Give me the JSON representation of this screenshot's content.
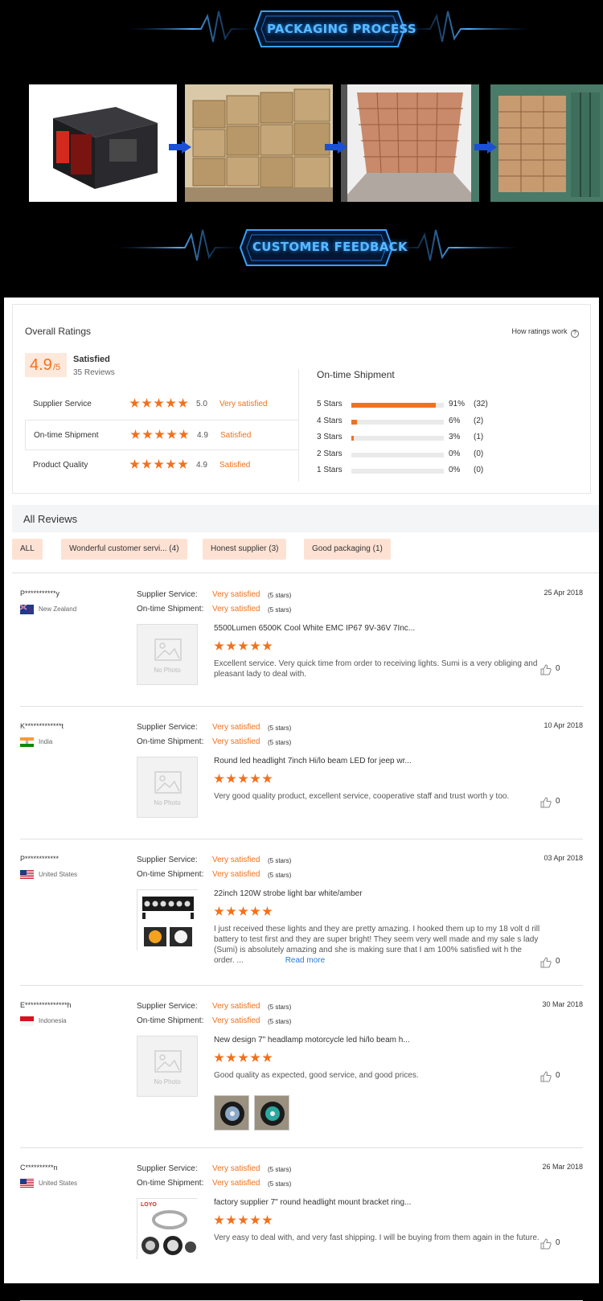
{
  "packaging": {
    "title": "PACKAGING PROCESS"
  },
  "feedback_banner": {
    "title": "CUSTOMER FEEDBACK"
  },
  "overall": {
    "title": "Overall Ratings",
    "how_link": "How ratings work",
    "score": "4.9",
    "score_suffix": "/5",
    "label": "Satisfied",
    "reviews": "35 Reviews",
    "rows": [
      {
        "label": "Supplier Service",
        "value": "5.0",
        "word": "Very satisfied"
      },
      {
        "label": "On-time Shipment",
        "value": "4.9",
        "word": "Satisfied"
      },
      {
        "label": "Product Quality",
        "value": "4.9",
        "word": "Satisfied"
      }
    ]
  },
  "ontime": {
    "title": "On-time Shipment",
    "rows": [
      {
        "label": "5 Stars",
        "pct": "91%",
        "count": "(32)",
        "fraction": 0.91
      },
      {
        "label": "4 Stars",
        "pct": "6%",
        "count": "(2)",
        "fraction": 0.06
      },
      {
        "label": "3 Stars",
        "pct": "3%",
        "count": "(1)",
        "fraction": 0.03
      },
      {
        "label": "2 Stars",
        "pct": "0%",
        "count": "(0)",
        "fraction": 0
      },
      {
        "label": "1 Stars",
        "pct": "0%",
        "count": "(0)",
        "fraction": 0
      }
    ]
  },
  "all_reviews": {
    "title": "All Reviews",
    "tags": [
      "ALL",
      "Wonderful customer servi... (4)",
      "Honest supplier (3)",
      "Good packaging (1)"
    ]
  },
  "review_labels": {
    "supplier": "Supplier Service:",
    "shipment": "On-time Shipment:",
    "no_photo": "No Photo",
    "read_more": "Read more"
  },
  "reviews": [
    {
      "name": "P***********y",
      "country": "New Zealand",
      "date": "25 Apr 2018",
      "supplier": "Very satisfied",
      "supplier_stars": "(5 stars)",
      "shipment": "Very satisfied",
      "shipment_stars": "(5 stars)",
      "product": "5500Lumen 6500K Cool White EMC IP67 9V-36V 7Inc...",
      "text": "Excellent service. Very quick time from order to receiving lights. Sumi is a very obliging and pleasant lady to deal with.",
      "likes": "0"
    },
    {
      "name": "K*************t",
      "country": "India",
      "date": "10 Apr 2018",
      "supplier": "Very satisfied",
      "supplier_stars": "(5 stars)",
      "shipment": "Very satisfied",
      "shipment_stars": "(5 stars)",
      "product": "Round led headlight 7inch Hi/lo beam LED for jeep wr...",
      "text": "Very good quality product, excellent service, cooperative staff  and trust worth y too.",
      "likes": "0"
    },
    {
      "name": "P************",
      "country": "United States",
      "date": "03 Apr 2018",
      "supplier": "Very satisfied",
      "supplier_stars": "(5 stars)",
      "shipment": "Very satisfied",
      "shipment_stars": "(5 stars)",
      "product": "22inch 120W strobe light bar white/amber",
      "text": "I just received these lights and they are pretty amazing. I hooked them up to my 18 volt d rill battery to test first and they are super bright! They seem very well made and my sale s lady (Sumi) is absolutely amazing and she is making sure that I am 100% satisfied wit h the order. ...",
      "likes": "0"
    },
    {
      "name": "E***************h",
      "country": "Indonesia",
      "date": "30 Mar 2018",
      "supplier": "Very satisfied",
      "supplier_stars": "(5 stars)",
      "shipment": "Very satisfied",
      "shipment_stars": "(5 stars)",
      "product": "New design 7\" headlamp motorcycle led hi/lo beam h...",
      "text": "Good quality as expected, good service, and good prices.",
      "likes": "0"
    },
    {
      "name": "C**********n",
      "country": "United States",
      "date": "26 Mar 2018",
      "supplier": "Very satisfied",
      "supplier_stars": "(5 stars)",
      "shipment": "Very satisfied",
      "shipment_stars": "(5 stars)",
      "product": "factory supplier 7\" round headlight mount bracket ring...",
      "text": "Very easy to deal with, and very fast shipping.  I will be buying from them again in the future.",
      "likes": "0"
    }
  ],
  "colors": {
    "accent": "#f2711c",
    "link": "#2a7ad8",
    "banner_glow": "#1e90ff"
  },
  "logo_text": "LOYO"
}
